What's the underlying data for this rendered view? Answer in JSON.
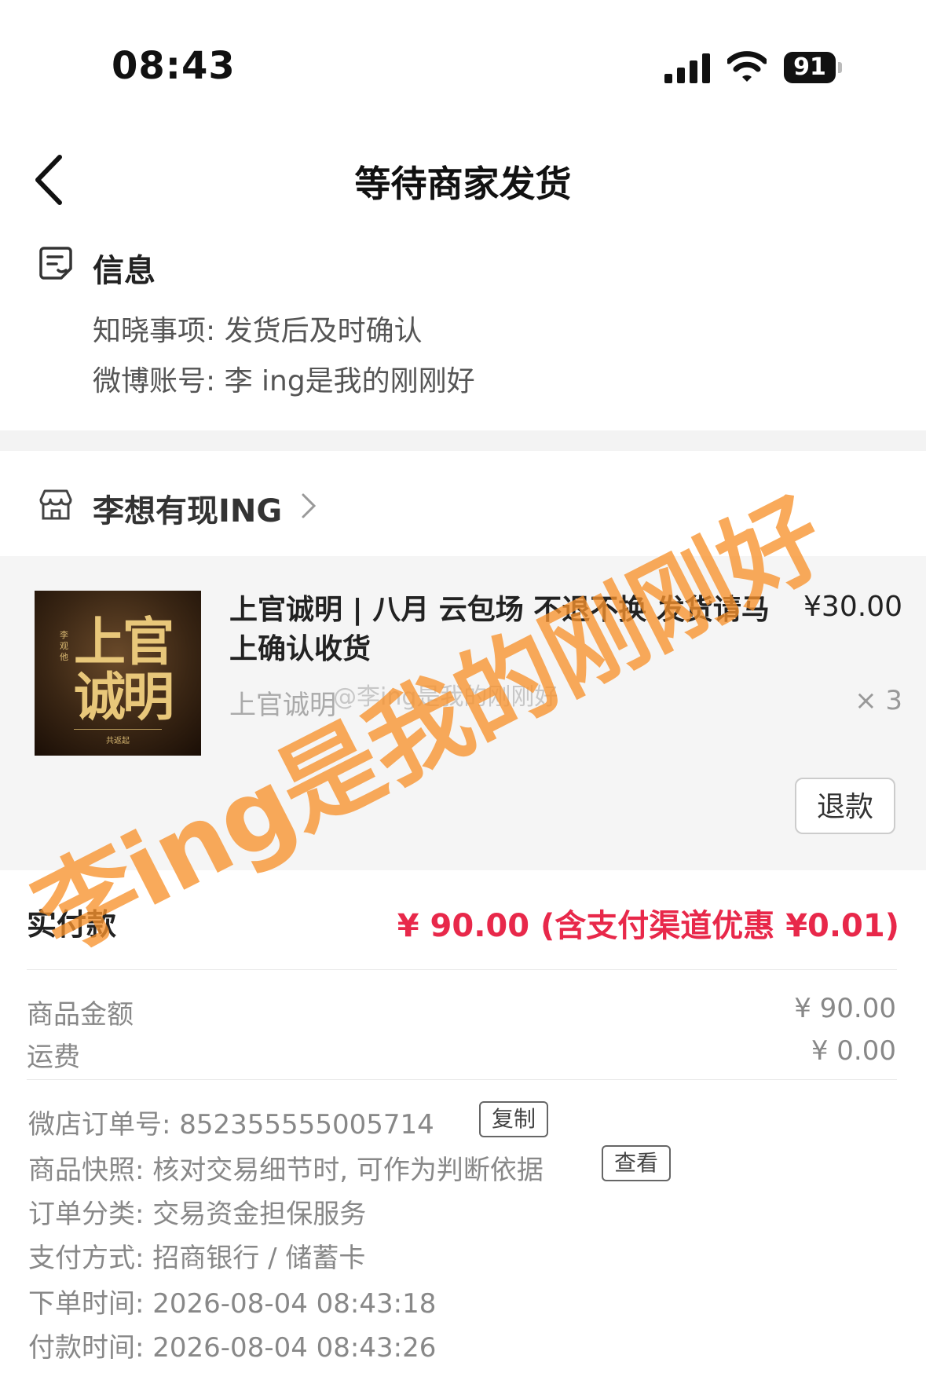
{
  "status_bar": {
    "time": "08:43",
    "battery": "91"
  },
  "nav": {
    "title": "等待商家发货"
  },
  "info": {
    "title": "信息",
    "lines": [
      "知晓事项: 发货后及时确认",
      "微博账号: 李 ing是我的刚刚好"
    ]
  },
  "shop": {
    "name": "李想有现ING"
  },
  "product": {
    "image_text": "上官诚明",
    "image_side_text": "李观他",
    "image_footer": "共返起",
    "title": "上官诚明 | 八月 云包场 不退不换 发货请马上确认收货",
    "price": "¥30.00",
    "spec": "上官诚明",
    "quantity": "× 3",
    "refund_label": "退款"
  },
  "payment": {
    "label": "实付款",
    "total": "¥ 90.00 (含支付渠道优惠 ¥0.01)",
    "rows": [
      {
        "label": "商品金额",
        "value": "¥ 90.00"
      },
      {
        "label": "运费",
        "value": "¥ 0.00"
      }
    ]
  },
  "details": {
    "order_no": "微店订单号:  852355555005714",
    "copy_label": "复制",
    "snapshot": "商品快照: 核对交易细节时, 可作为判断依据",
    "view_label": "查看",
    "category": "订单分类:  交易资金担保服务",
    "payment_method": "支付方式:  招商银行 / 储蓄卡",
    "order_time": "下单时间:  2026-08-04 08:43:18",
    "pay_time": "付款时间:  2026-08-04 08:43:26"
  },
  "watermark": {
    "small": "@李ing是我的刚刚好",
    "big": "李ing是我的刚刚好"
  },
  "colors": {
    "accent_red": "#e8284a",
    "watermark_orange": "#f7922d"
  }
}
